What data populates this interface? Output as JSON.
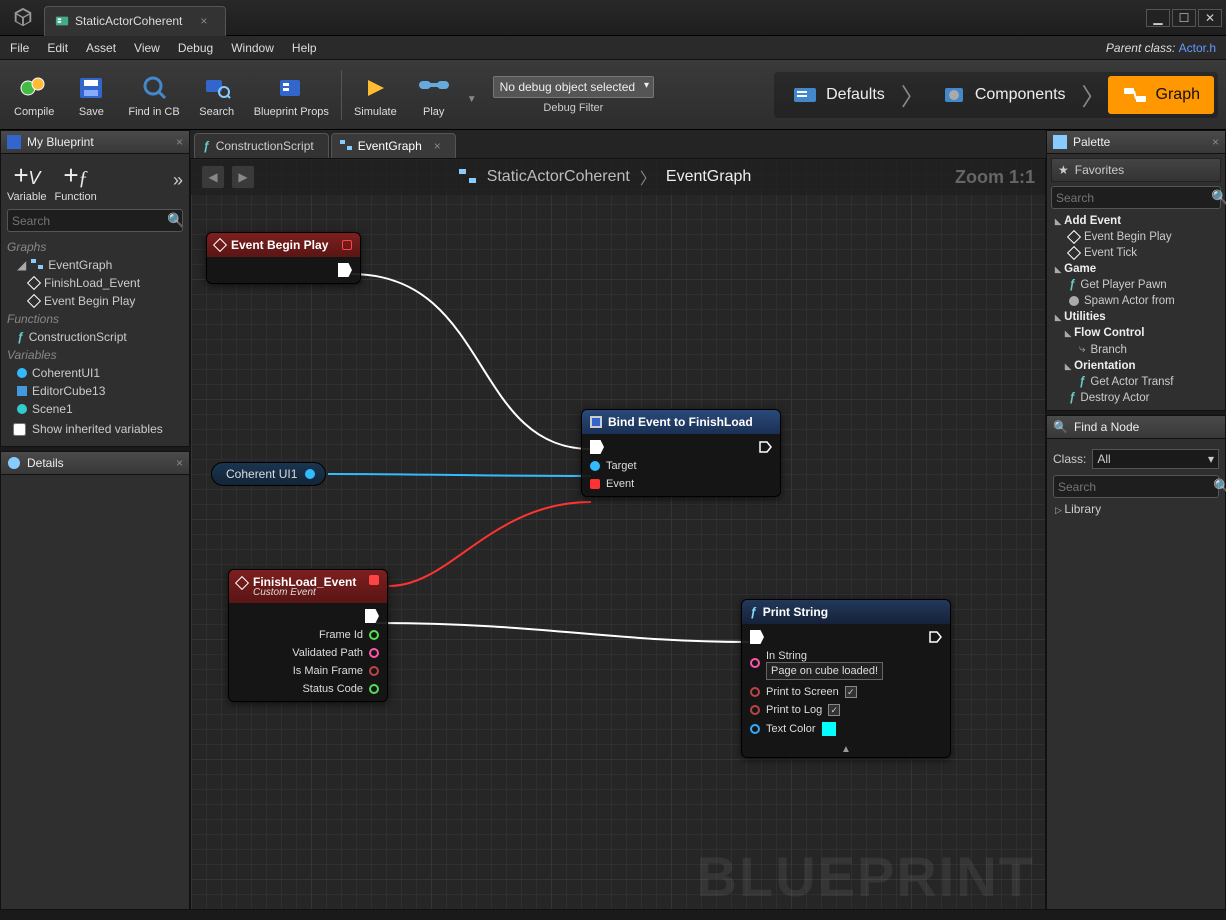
{
  "title_tab": "StaticActorCoherent",
  "menu": {
    "file": "File",
    "edit": "Edit",
    "asset": "Asset",
    "view": "View",
    "debug": "Debug",
    "window": "Window",
    "help": "Help"
  },
  "parent_class_label": "Parent class:",
  "parent_class_value": "Actor.h",
  "toolbar": {
    "compile": "Compile",
    "save": "Save",
    "find": "Find in CB",
    "search": "Search",
    "props": "Blueprint Props",
    "simulate": "Simulate",
    "play": "Play",
    "debug_object": "No debug object selected",
    "debug_filter": "Debug Filter"
  },
  "mode_tabs": {
    "defaults": "Defaults",
    "components": "Components",
    "graph": "Graph"
  },
  "panels": {
    "my_blueprint": "My Blueprint",
    "details": "Details",
    "palette": "Palette",
    "favorites": "Favorites",
    "find_node": "Find a Node"
  },
  "mbp": {
    "variable": "Variable",
    "function": "Function",
    "search_placeholder": "Search",
    "cat_graphs": "Graphs",
    "eventgraph": "EventGraph",
    "finishload": "FinishLoad_Event",
    "beginplay": "Event Begin Play",
    "cat_functions": "Functions",
    "constructionscript": "ConstructionScript",
    "cat_variables": "Variables",
    "var1": "CoherentUI1",
    "var2": "EditorCube13",
    "var3": "Scene1",
    "show_inherited": "Show inherited variables"
  },
  "center_tabs": {
    "construction": "ConstructionScript",
    "eventgraph": "EventGraph"
  },
  "breadcrumb": {
    "root": "StaticActorCoherent",
    "leaf": "EventGraph"
  },
  "zoom": "Zoom 1:1",
  "watermark": "BLUEPRINT",
  "nodes": {
    "beginplay_title": "Event Begin Play",
    "coherent_var": "Coherent UI1",
    "bind_title": "Bind Event to FinishLoad",
    "bind_target": "Target",
    "bind_event": "Event",
    "finishload_title": "FinishLoad_Event",
    "finishload_sub": "Custom Event",
    "fl_frame": "Frame Id",
    "fl_path": "Validated Path",
    "fl_main": "Is Main Frame",
    "fl_status": "Status Code",
    "print_title": "Print String",
    "print_instring": "In String",
    "print_value": "Page on cube loaded!",
    "print_screen": "Print to Screen",
    "print_log": "Print to Log",
    "print_color": "Text Color"
  },
  "palette": {
    "search_placeholder": "Search",
    "add_event": "Add Event",
    "ev_begin": "Event Begin Play",
    "ev_tick": "Event Tick",
    "game": "Game",
    "get_pawn": "Get Player Pawn",
    "spawn": "Spawn Actor from",
    "utilities": "Utilities",
    "flow": "Flow Control",
    "branch": "Branch",
    "orientation": "Orientation",
    "get_transform": "Get Actor Transf",
    "destroy": "Destroy Actor"
  },
  "findnode": {
    "class_label": "Class:",
    "class_value": "All",
    "search_placeholder": "Search",
    "library": "Library"
  }
}
